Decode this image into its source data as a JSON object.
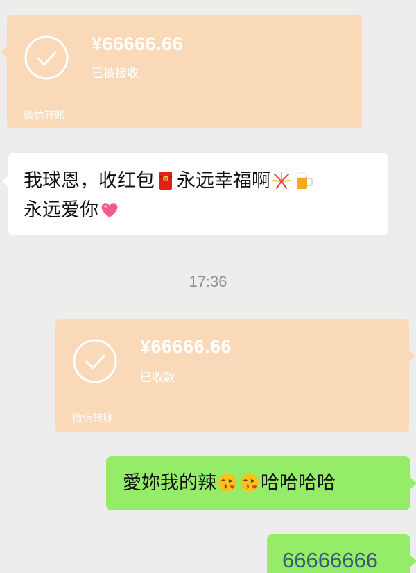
{
  "messages": {
    "transfer_1": {
      "amount": "¥66666.66",
      "status": "已被接收",
      "footer": "微信转账"
    },
    "incoming_text": {
      "line1_part1": "我球恩，收红包",
      "line1_part2": "永远幸福啊",
      "line2": "永远爱你",
      "emojis": [
        "red-envelope-emoji",
        "fireworks-emoji",
        "beer-mug-emoji",
        "heart-emoji"
      ]
    },
    "timestamp": "17:36",
    "transfer_2": {
      "amount": "¥66666.66",
      "status": "已收款",
      "footer": "微信转账"
    },
    "outgoing_1": {
      "part1": "愛妳我的辣",
      "part2": "哈哈哈哈",
      "emojis": [
        "kissing-face-emoji",
        "kissing-face-emoji"
      ]
    },
    "outgoing_2": {
      "text": "66666666"
    }
  },
  "colors": {
    "background": "#ededed",
    "transfer_card": "#fad9b9",
    "incoming_bubble": "#ffffff",
    "outgoing_bubble": "#95ec69"
  }
}
